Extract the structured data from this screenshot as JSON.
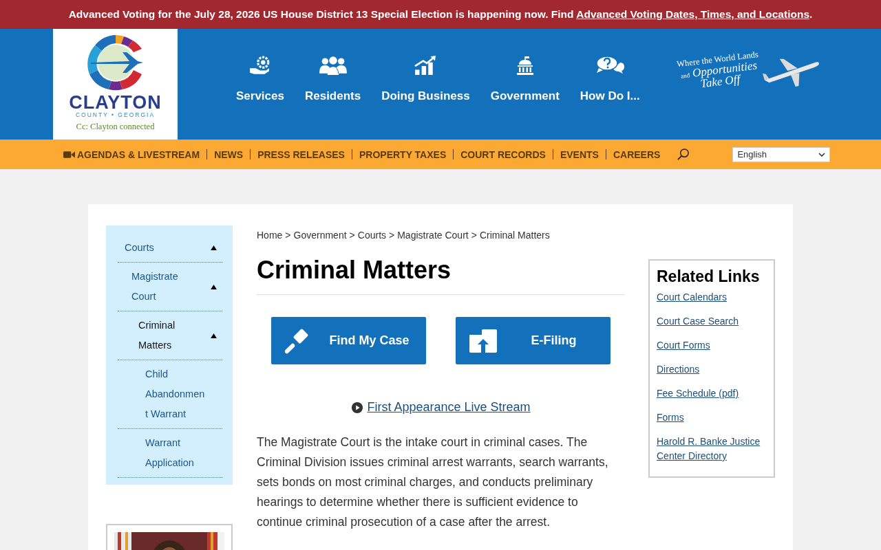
{
  "alert": {
    "text": "Advanced Voting for the July 28, 2026 US House District 13 Special Election is happening now. Find ",
    "link": "Advanced Voting Dates, Times, and Locations",
    "end": "."
  },
  "logo": {
    "name": "CLAYTON",
    "region": "COUNTY • GEORGIA",
    "slogan": "Cc: Clayton connected"
  },
  "main_nav": [
    {
      "label": "Services",
      "kind": "service"
    },
    {
      "label": "Residents",
      "kind": "people"
    },
    {
      "label": "Doing Business",
      "kind": "chart"
    },
    {
      "label": "Government",
      "kind": "capitol"
    },
    {
      "label": "How Do I...",
      "kind": "question"
    }
  ],
  "tagline": {
    "line1": "Where the World Lands",
    "small": "and",
    "line2": "Opportunities",
    "line3": "Take Off"
  },
  "top_links": [
    {
      "label": "AGENDAS & LIVESTREAM",
      "video": true
    },
    {
      "label": "NEWS",
      "video": false
    },
    {
      "label": "PRESS RELEASES",
      "video": false
    },
    {
      "label": "PROPERTY TAXES",
      "video": false
    },
    {
      "label": "COURT RECORDS",
      "video": false
    },
    {
      "label": "EVENTS",
      "video": false
    },
    {
      "label": "CAREERS",
      "video": false
    }
  ],
  "language": {
    "value": "English"
  },
  "sidebar": {
    "items": [
      {
        "label": "Courts",
        "expanded": true,
        "selected": false,
        "children": [
          {
            "label": "Magistrate Court",
            "expanded": true,
            "selected": false,
            "children": [
              {
                "label": "Criminal Matters",
                "expanded": true,
                "selected": true,
                "children": [
                  {
                    "label": "Child Abandonment Warrant",
                    "selected": false
                  },
                  {
                    "label": "Warrant Application",
                    "selected": false
                  }
                ]
              }
            ]
          }
        ]
      }
    ]
  },
  "breadcrumb": {
    "items": [
      "Home",
      "Government",
      "Courts",
      "Magistrate Court",
      "Criminal Matters"
    ],
    "separator": ">"
  },
  "title": "Criminal Matters",
  "buttons": [
    {
      "label": "Find My Case",
      "kind": "gavel"
    },
    {
      "label": "E-Filing",
      "kind": "upload"
    }
  ],
  "stream_link": "First Appearance Live Stream",
  "body": "The Magistrate Court is the intake court in criminal cases. The Criminal Division issues criminal arrest warrants,  search warrants, sets bonds on most criminal charges, and conducts preliminary hearings to determine whether there is sufficient evidence to continue criminal prosecution of a case after the arrest.",
  "related": {
    "title": "Related Links",
    "links": [
      "Court Calendars",
      "Court Case Search",
      "Court Forms",
      "Directions",
      "Fee Schedule (pdf)",
      "Forms",
      "Harold R. Banke Justice Center Directory"
    ]
  }
}
